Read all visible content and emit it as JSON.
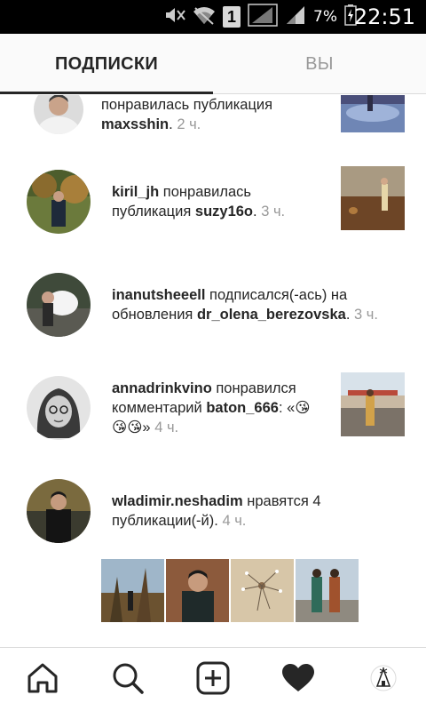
{
  "status_bar": {
    "battery_percent": "7%",
    "sim_slot": "1",
    "time": "22:51",
    "icons": [
      "mute-icon",
      "wifi-icon",
      "sim-icon",
      "signal-icon",
      "signal-icon",
      "battery-charging-icon"
    ]
  },
  "tabs": {
    "following": "ПОДПИСКИ",
    "you": "ВЫ",
    "active": "following"
  },
  "feed": [
    {
      "user": "",
      "action": "понравилась публикация",
      "target": "maxsshin",
      "suffix": ".",
      "time": "2 ч.",
      "has_thumb": true
    },
    {
      "user": "kiril_jh",
      "action": "понравилась публикация",
      "target": "suzy16o",
      "suffix": ".",
      "time": "3 ч.",
      "has_thumb": true
    },
    {
      "user": "inanutsheeell",
      "action": "подписался(-ась) на обновления",
      "target": "dr_olena_berezovska",
      "suffix": ".",
      "time": "3 ч.",
      "has_thumb": false
    },
    {
      "user": "annadrinkvino",
      "action": "понравился комментарий",
      "target": "baton_666",
      "suffix": ": «😘😘😘»",
      "time": "4 ч.",
      "has_thumb": true
    },
    {
      "user": "wladimir.neshadim",
      "action": "нравятся 4 публикации(-й).",
      "target": "",
      "suffix": "",
      "time": "4 ч.",
      "has_thumb": false,
      "grid_count": 4
    }
  ],
  "bottom_nav": {
    "items": [
      "home-icon",
      "search-icon",
      "add-post-icon",
      "activity-heart-icon",
      "profile-avatar-icon"
    ],
    "active": "activity-heart-icon"
  },
  "colors": {
    "text": "#262626",
    "muted": "#999999",
    "divider": "#dbdbdb",
    "statusbar": "#000000",
    "header_bg": "#fafafa"
  }
}
